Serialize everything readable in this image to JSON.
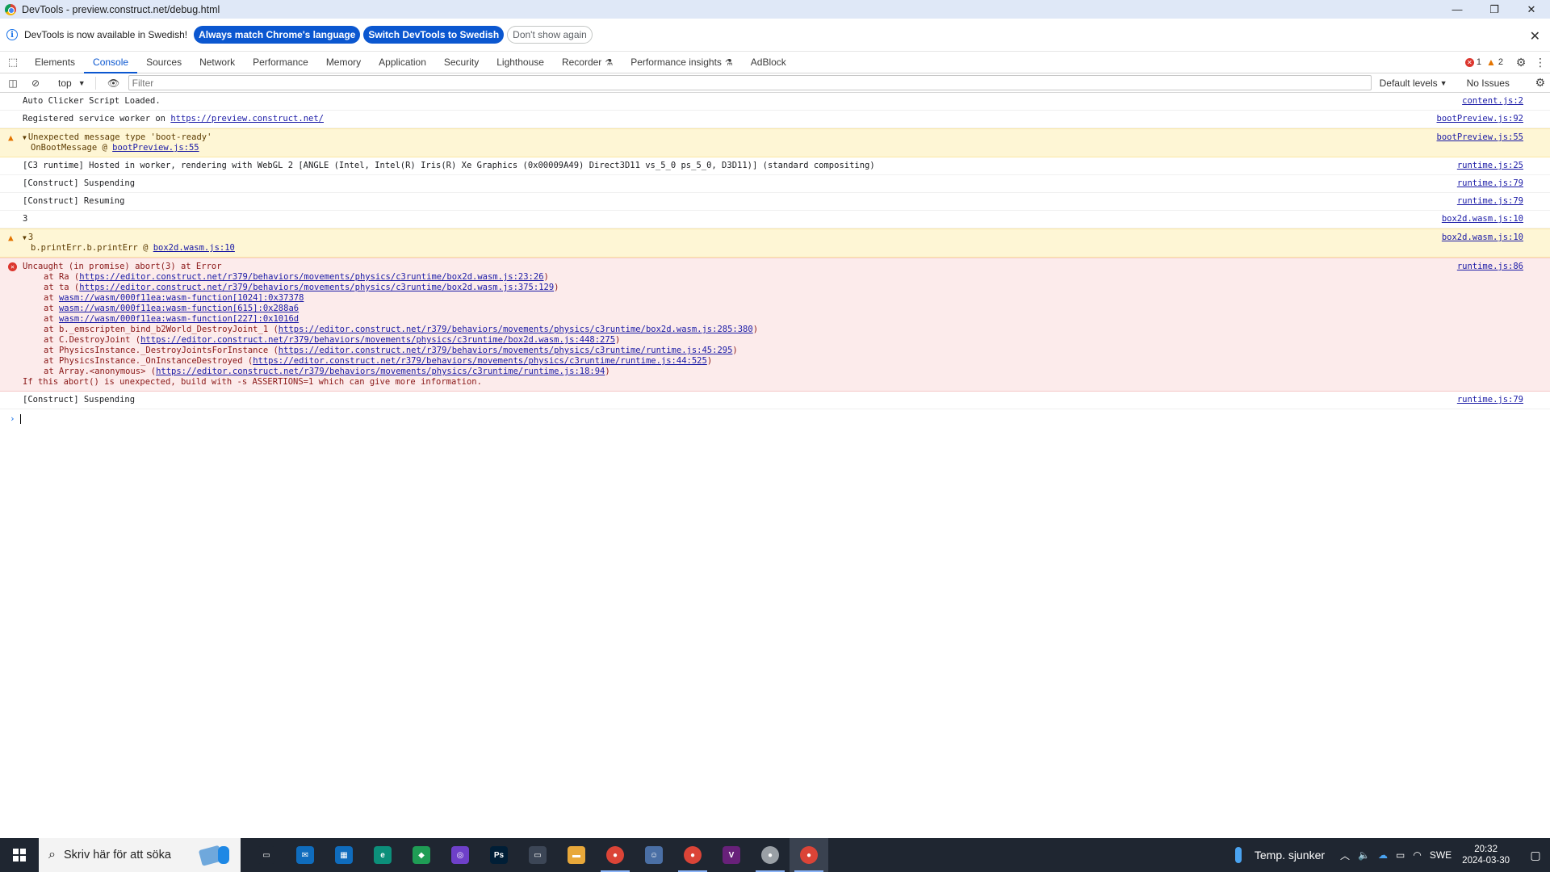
{
  "window": {
    "title": "DevTools - preview.construct.net/debug.html",
    "controls": {
      "minimize": "—",
      "restore": "❐",
      "close": "✕"
    }
  },
  "infobar": {
    "message": "DevTools is now available in Swedish!",
    "btn_match": "Always match Chrome's language",
    "btn_switch": "Switch DevTools to Swedish",
    "btn_dismiss": "Don't show again"
  },
  "tabs": [
    "Elements",
    "Console",
    "Sources",
    "Network",
    "Performance",
    "Memory",
    "Application",
    "Security",
    "Lighthouse",
    "Recorder",
    "Performance insights",
    "AdBlock"
  ],
  "counts": {
    "errors": "1",
    "warnings": "2"
  },
  "toolbar": {
    "context": "top",
    "filter_placeholder": "Filter",
    "levels": "Default levels",
    "issues": "No Issues"
  },
  "console": {
    "m1": {
      "text": "Auto Clicker Script Loaded.",
      "src": "content.js:2"
    },
    "m2": {
      "text": "Registered service worker on ",
      "link": "https://preview.construct.net/",
      "src": "bootPreview.js:92"
    },
    "m3": {
      "text": "Unexpected message type 'boot-ready'",
      "sub_text": "OnBootMessage @ ",
      "sub_link": "bootPreview.js:55",
      "src": "bootPreview.js:55"
    },
    "m4": {
      "text": "[C3 runtime] Hosted in worker, rendering with WebGL 2 [ANGLE (Intel, Intel(R) Iris(R) Xe Graphics (0x00009A49) Direct3D11 vs_5_0 ps_5_0, D3D11)] (standard compositing)",
      "src": "runtime.js:25"
    },
    "m5": {
      "text": "[Construct] Suspending",
      "src": "runtime.js:79"
    },
    "m6": {
      "text": "[Construct] Resuming",
      "src": "runtime.js:79"
    },
    "m7": {
      "text": "3",
      "src": "box2d.wasm.js:10"
    },
    "m8": {
      "text": "3",
      "sub_text": "b.printErr.b.printErr @ ",
      "sub_link": "box2d.wasm.js:10",
      "src": "box2d.wasm.js:10"
    },
    "m9": {
      "text": "Uncaught (in promise) abort(3) at Error",
      "src": "runtime.js:86",
      "stack": [
        {
          "pre": "at Ra (",
          "link": "https://editor.construct.net/r379/behaviors/movements/physics/c3runtime/box2d.wasm.js:23:26",
          "post": ")"
        },
        {
          "pre": "at ta (",
          "link": "https://editor.construct.net/r379/behaviors/movements/physics/c3runtime/box2d.wasm.js:375:129",
          "post": ")"
        },
        {
          "pre": "at ",
          "link": "wasm://wasm/000f11ea:wasm-function[1024]:0x37378",
          "post": ""
        },
        {
          "pre": "at ",
          "link": "wasm://wasm/000f11ea:wasm-function[615]:0x288a6",
          "post": ""
        },
        {
          "pre": "at ",
          "link": "wasm://wasm/000f11ea:wasm-function[227]:0x1016d",
          "post": ""
        },
        {
          "pre": "at b._emscripten_bind_b2World_DestroyJoint_1 (",
          "link": "https://editor.construct.net/r379/behaviors/movements/physics/c3runtime/box2d.wasm.js:285:380",
          "post": ")"
        },
        {
          "pre": "at C.DestroyJoint (",
          "link": "https://editor.construct.net/r379/behaviors/movements/physics/c3runtime/box2d.wasm.js:448:275",
          "post": ")"
        },
        {
          "pre": "at PhysicsInstance._DestroyJointsForInstance (",
          "link": "https://editor.construct.net/r379/behaviors/movements/physics/c3runtime/runtime.js:45:295",
          "post": ")"
        },
        {
          "pre": "at PhysicsInstance._OnInstanceDestroyed (",
          "link": "https://editor.construct.net/r379/behaviors/movements/physics/c3runtime/runtime.js:44:525",
          "post": ")"
        },
        {
          "pre": "at Array.<anonymous> (",
          "link": "https://editor.construct.net/r379/behaviors/movements/physics/c3runtime/runtime.js:18:94",
          "post": ")"
        }
      ],
      "footer": "If this abort() is unexpected, build with -s ASSERTIONS=1 which can give more information."
    },
    "m10": {
      "text": "[Construct] Suspending",
      "src": "runtime.js:79"
    }
  },
  "taskbar": {
    "search_placeholder": "Skriv här för att söka",
    "weather": "Temp. sjunker",
    "lang": "SWE",
    "time": "20:32",
    "date": "2024-03-30",
    "apps": [
      {
        "name": "task-view",
        "label": "▭",
        "color": "#1f2631"
      },
      {
        "name": "mail",
        "label": "✉",
        "color": "#0f6cbd"
      },
      {
        "name": "store",
        "label": "▦",
        "color": "#0f6cbd"
      },
      {
        "name": "edge",
        "label": "e",
        "color": "#0c8f7a"
      },
      {
        "name": "app-green",
        "label": "◆",
        "color": "#1f9d55"
      },
      {
        "name": "github",
        "label": "◎",
        "color": "#6e40c9"
      },
      {
        "name": "photoshop",
        "label": "Ps",
        "color": "#001e36"
      },
      {
        "name": "monitor",
        "label": "▭",
        "color": "#3c4656"
      },
      {
        "name": "explorer",
        "label": "▬",
        "color": "#e8a83a"
      },
      {
        "name": "chrome-1",
        "label": "●",
        "color": "#db4437"
      },
      {
        "name": "app-bot",
        "label": "☺",
        "color": "#4a6fa5"
      },
      {
        "name": "chrome-2",
        "label": "●",
        "color": "#db4437"
      },
      {
        "name": "visual-studio",
        "label": "V",
        "color": "#68217a"
      },
      {
        "name": "chrome-3",
        "label": "●",
        "color": "#9aa0a6"
      },
      {
        "name": "chrome-4",
        "label": "●",
        "color": "#db4437"
      }
    ]
  }
}
